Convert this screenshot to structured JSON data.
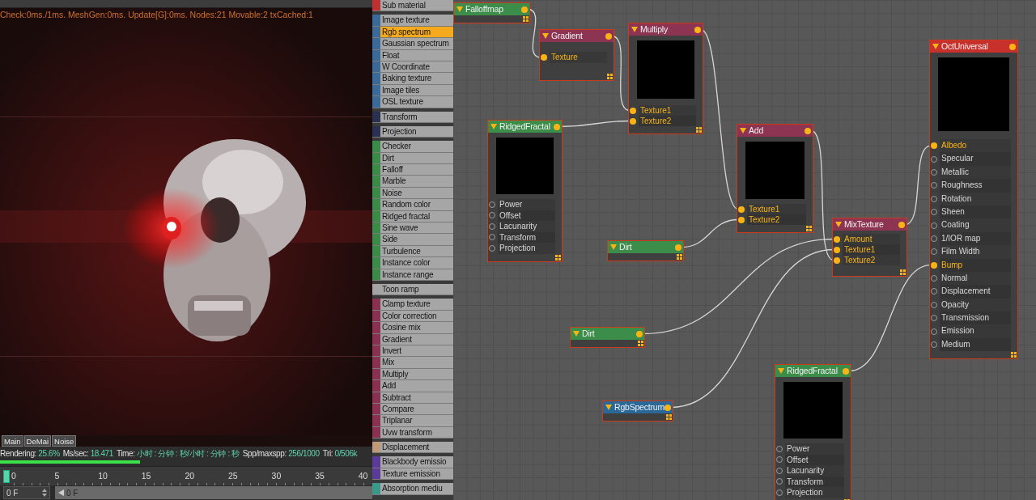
{
  "viewport": {
    "stats": "Check:0ms./1ms. MeshGen:0ms. Update[G]:0ms. Nodes:21 Movable:2 txCached:1",
    "tabs": [
      {
        "label": "Main"
      },
      {
        "label": "DeMai"
      },
      {
        "label": "Noise"
      }
    ],
    "status": [
      {
        "label": "Rendering:",
        "value": "25.6%"
      },
      {
        "label": "Ms/sec:",
        "value": "18.471"
      },
      {
        "label": "Time:",
        "value": "小时 : 分钟 : 秒/小时 : 分钟 : 秒"
      },
      {
        "label": "Spp/maxspp:",
        "value": "256/1000"
      },
      {
        "label": "Tri:",
        "value": "0/506k"
      }
    ],
    "progress": {
      "level": 0.375
    },
    "timeline": {
      "ticks": [
        "0",
        "5",
        "10",
        "15",
        "20",
        "25",
        "30",
        "35",
        "40"
      ]
    },
    "frame_field": {
      "value": "0 F"
    },
    "frame_bar": {
      "value": "0 F"
    }
  },
  "sidebar": {
    "groups": [
      {
        "color": "#c03030",
        "items": [
          {
            "label": "Sub material",
            "selected": false
          }
        ]
      },
      {
        "color": "#3a6a9a",
        "items": [
          {
            "label": "Image texture",
            "selected": false
          },
          {
            "label": "Rgb spectrum",
            "selected": true
          },
          {
            "label": "Gaussian spectrum",
            "selected": false
          },
          {
            "label": "Float",
            "selected": false
          },
          {
            "label": "W Coordinate",
            "selected": false
          },
          {
            "label": "Baking texture",
            "selected": false
          },
          {
            "label": "Image tiles",
            "selected": false
          },
          {
            "label": "OSL texture",
            "selected": false
          }
        ]
      },
      {
        "color": "#2a3050",
        "items": [
          {
            "label": "Transform",
            "selected": false
          }
        ]
      },
      {
        "color": "#2a3050",
        "items": [
          {
            "label": "Projection",
            "selected": false
          }
        ]
      },
      {
        "color": "#3a8a48",
        "items": [
          {
            "label": "Checker",
            "selected": false
          },
          {
            "label": "Dirt",
            "selected": false
          },
          {
            "label": "Falloff",
            "selected": false
          },
          {
            "label": "Marble",
            "selected": false
          },
          {
            "label": "Noise",
            "selected": false
          },
          {
            "label": "Random color",
            "selected": false
          },
          {
            "label": "Ridged fractal",
            "selected": false
          },
          {
            "label": "Sine wave",
            "selected": false
          },
          {
            "label": "Side",
            "selected": false
          },
          {
            "label": "Turbulence",
            "selected": false
          },
          {
            "label": "Instance color",
            "selected": false
          },
          {
            "label": "Instance range",
            "selected": false
          }
        ]
      },
      {
        "color": "#a4a4a4",
        "items": [
          {
            "label": "Toon ramp",
            "selected": false
          }
        ]
      },
      {
        "color": "#8a3050",
        "items": [
          {
            "label": "Clamp texture",
            "selected": false
          },
          {
            "label": "Color correction",
            "selected": false
          },
          {
            "label": "Cosine mix",
            "selected": false
          },
          {
            "label": "Gradient",
            "selected": false
          },
          {
            "label": "Invert",
            "selected": false
          },
          {
            "label": "Mix",
            "selected": false
          },
          {
            "label": "Multiply",
            "selected": false
          },
          {
            "label": "Add",
            "selected": false
          },
          {
            "label": "Subtract",
            "selected": false
          },
          {
            "label": "Compare",
            "selected": false
          },
          {
            "label": "Triplanar",
            "selected": false
          },
          {
            "label": "Uvw transform",
            "selected": false
          }
        ]
      },
      {
        "color": "#c09a78",
        "items": [
          {
            "label": "Displacement",
            "selected": false
          }
        ]
      },
      {
        "color": "#5a3a9a",
        "items": [
          {
            "label": "Blackbody emissio",
            "selected": false
          },
          {
            "label": "Texture emission",
            "selected": false
          }
        ]
      },
      {
        "color": "#3a9a8a",
        "items": [
          {
            "label": "Absorption mediu",
            "selected": false
          }
        ]
      }
    ]
  },
  "nodes": [
    {
      "title": "Falloffmap",
      "color": "#3c8c4a",
      "preview": false
    },
    {
      "title": "Gradient",
      "color": "#8c3452",
      "preview": false,
      "ports": [
        {
          "label": "Texture",
          "connected": true
        }
      ]
    },
    {
      "title": "Multiply",
      "color": "#8c3452",
      "preview": true,
      "ports": [
        {
          "label": "Texture1",
          "connected": true
        },
        {
          "label": "Texture2",
          "connected": true
        }
      ]
    },
    {
      "title": "RidgedFractal",
      "color": "#3c8c4a",
      "preview": true,
      "ports": [
        {
          "label": "Power",
          "connected": false
        },
        {
          "label": "Offset",
          "connected": false
        },
        {
          "label": "Lacunarity",
          "connected": false
        },
        {
          "label": "Transform",
          "connected": false
        },
        {
          "label": "Projection",
          "connected": false
        }
      ]
    },
    {
      "title": "Add",
      "color": "#8c3452",
      "preview": true,
      "ports": [
        {
          "label": "Texture1",
          "connected": true
        },
        {
          "label": "Texture2",
          "connected": true
        }
      ]
    },
    {
      "title": "Dirt",
      "color": "#3c8c4a",
      "preview": false
    },
    {
      "title": "MixTexture",
      "color": "#8c3452",
      "preview": false,
      "ports": [
        {
          "label": "Amount",
          "connected": true
        },
        {
          "label": "Texture1",
          "connected": true
        },
        {
          "label": "Texture2",
          "connected": true
        }
      ]
    },
    {
      "title": "OctUniversal",
      "color": "#c8302c",
      "preview": true,
      "ports": [
        {
          "label": "Albedo",
          "connected": true
        },
        {
          "label": "Specular",
          "connected": false
        },
        {
          "label": "Metallic",
          "connected": false
        },
        {
          "label": "Roughness",
          "connected": false
        },
        {
          "label": "Rotation",
          "connected": false
        },
        {
          "label": "Sheen",
          "connected": false
        },
        {
          "label": "Coating",
          "connected": false
        },
        {
          "label": "1/IOR map",
          "connected": false
        },
        {
          "label": "Film Width",
          "connected": false
        },
        {
          "label": "Bump",
          "connected": true
        },
        {
          "label": "Normal",
          "connected": false
        },
        {
          "label": "Displacement",
          "connected": false
        },
        {
          "label": "Opacity",
          "connected": false
        },
        {
          "label": "Transmission",
          "connected": false
        },
        {
          "label": "Emission",
          "connected": false
        },
        {
          "label": "Medium",
          "connected": false
        }
      ]
    },
    {
      "title": "Dirt",
      "color": "#3c8c4a",
      "preview": false
    },
    {
      "title": "RgbSpectrum",
      "color": "#2a6898",
      "preview": false
    },
    {
      "title": "RidgedFractal",
      "color": "#3c8c4a",
      "preview": true,
      "ports": [
        {
          "label": "Power",
          "connected": false
        },
        {
          "label": "Offset",
          "connected": false
        },
        {
          "label": "Lacunarity",
          "connected": false
        },
        {
          "label": "Transform",
          "connected": false
        },
        {
          "label": "Projection",
          "connected": false
        }
      ]
    }
  ]
}
